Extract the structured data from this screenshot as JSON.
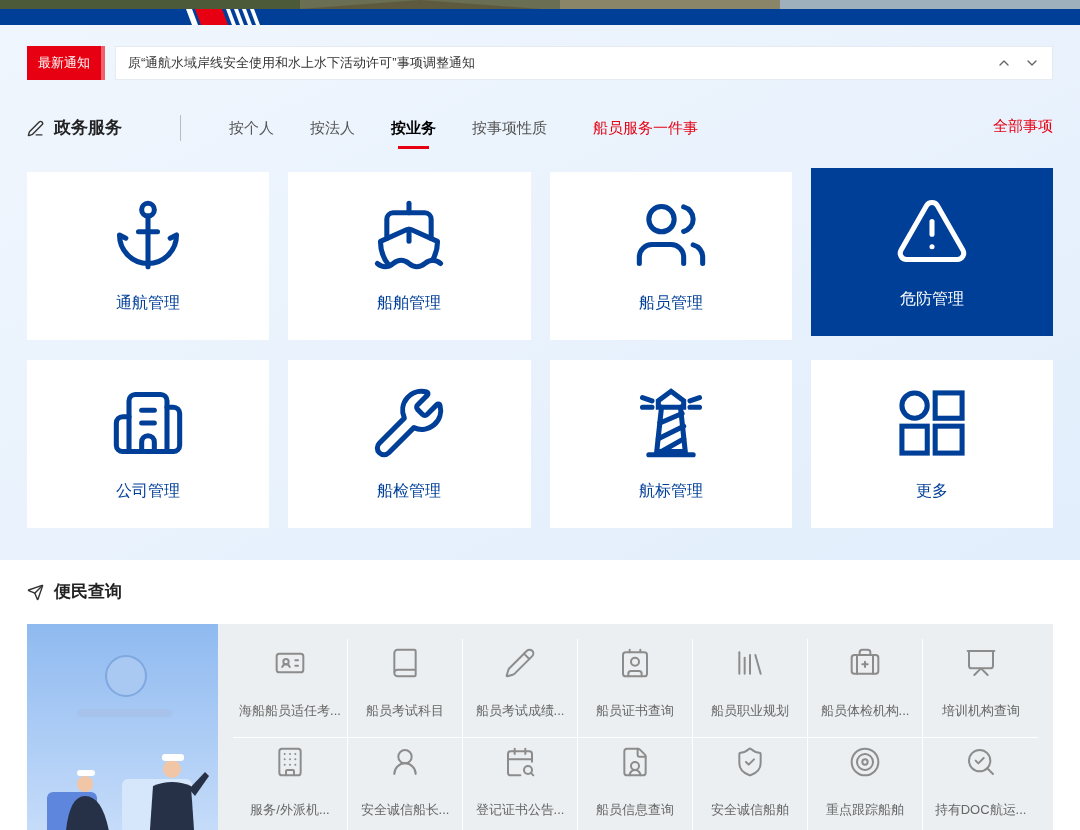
{
  "notice": {
    "label": "最新通知",
    "text": "原“通航水域岸线安全使用和水上水下活动许可”事项调整通知"
  },
  "gov_services": {
    "title": "政务服务",
    "tabs": [
      {
        "label": "按个人",
        "selected": false
      },
      {
        "label": "按法人",
        "selected": false
      },
      {
        "label": "按业务",
        "selected": true
      },
      {
        "label": "按事项性质",
        "selected": false
      }
    ],
    "service_link": "船员服务一件事",
    "all_link": "全部事项",
    "cards": [
      {
        "label": "通航管理",
        "selected": false
      },
      {
        "label": "船舶管理",
        "selected": false
      },
      {
        "label": "船员管理",
        "selected": false
      },
      {
        "label": "危防管理",
        "selected": true
      },
      {
        "label": "公司管理",
        "selected": false
      },
      {
        "label": "船检管理",
        "selected": false
      },
      {
        "label": "航标管理",
        "selected": false
      },
      {
        "label": "更多",
        "selected": false
      }
    ]
  },
  "public_query": {
    "title": "便民查询",
    "items": [
      "海船船员适任考...",
      "船员考试科目",
      "船员考试成绩...",
      "船员证书查询",
      "船员职业规划",
      "船员体检机构...",
      "培训机构查询",
      "服务/外派机...",
      "安全诚信船长...",
      "登记证书公告...",
      "船员信息查询",
      "安全诚信船舶",
      "重点跟踪船舶",
      "持有DOC航运..."
    ]
  }
}
